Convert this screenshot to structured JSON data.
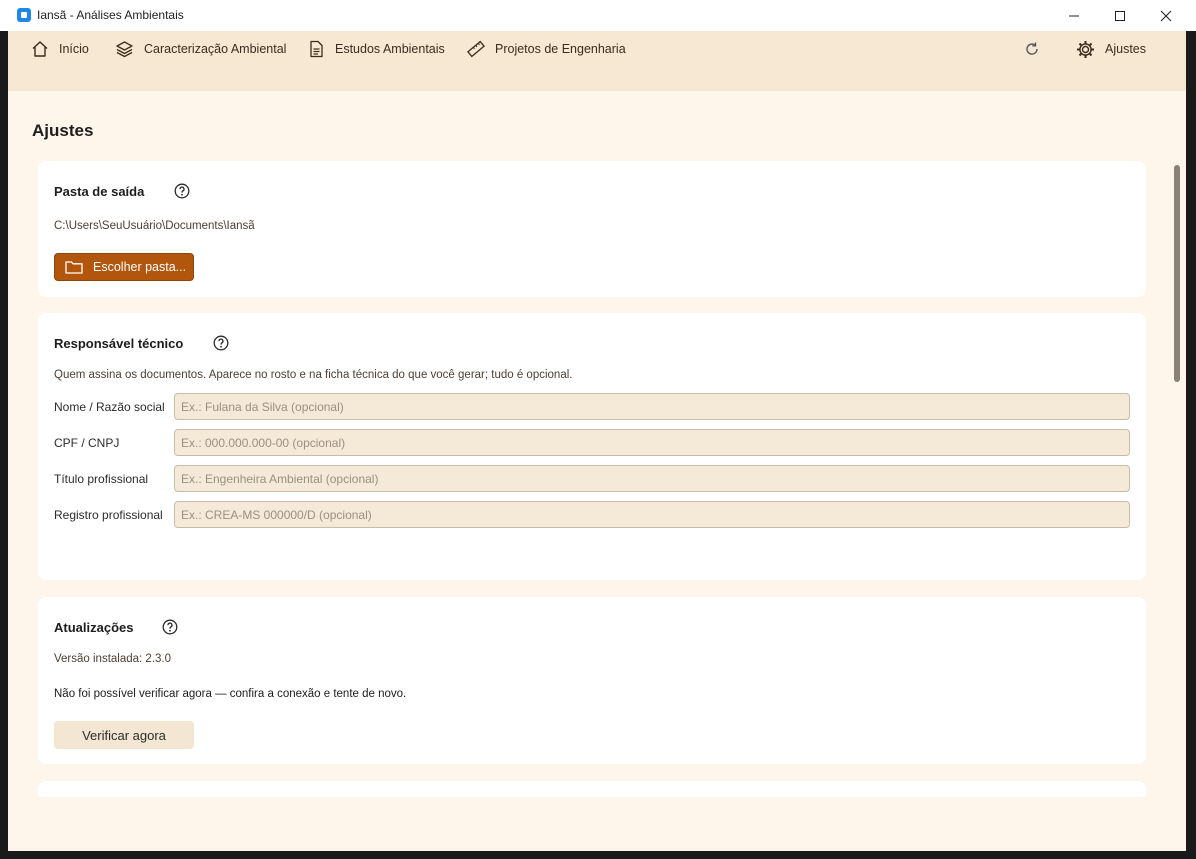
{
  "window": {
    "title": "Iansã - Análises Ambientais"
  },
  "nav": {
    "items": [
      {
        "label": "Início",
        "icon": "home-icon"
      },
      {
        "label": "Caracterização Ambiental",
        "icon": "layers-icon"
      },
      {
        "label": "Estudos Ambientais",
        "icon": "document-icon"
      },
      {
        "label": "Projetos de Engenharia",
        "icon": "ruler-icon"
      }
    ],
    "settings_label": "Ajustes"
  },
  "page": {
    "title": "Ajustes"
  },
  "output_folder": {
    "title": "Pasta de saída",
    "path": "C:\\Users\\SeuUsuário\\Documents\\Iansã",
    "button_label": "Escolher pasta..."
  },
  "responsible": {
    "title": "Responsável técnico",
    "description": "Quem assina os documentos. Aparece no rosto e na ficha técnica do que você gerar; tudo é opcional.",
    "fields": [
      {
        "label": "Nome / Razão social",
        "placeholder": "Ex.: Fulana da Silva (opcional)",
        "value": ""
      },
      {
        "label": "CPF / CNPJ",
        "placeholder": "Ex.: 000.000.000-00 (opcional)",
        "value": ""
      },
      {
        "label": "Título profissional",
        "placeholder": "Ex.: Engenheira Ambiental (opcional)",
        "value": ""
      },
      {
        "label": "Registro profissional",
        "placeholder": "Ex.: CREA-MS 000000/D (opcional)",
        "value": ""
      }
    ]
  },
  "updates": {
    "title": "Atualizações",
    "version": "Versão instalada: 2.3.0",
    "status": "Não foi possível verificar agora — confira a conexão e tente de novo.",
    "button_label": "Verificar agora"
  },
  "colors": {
    "accent": "#b1560c",
    "background": "#fef6ea",
    "navbar": "#f6e8d3"
  }
}
